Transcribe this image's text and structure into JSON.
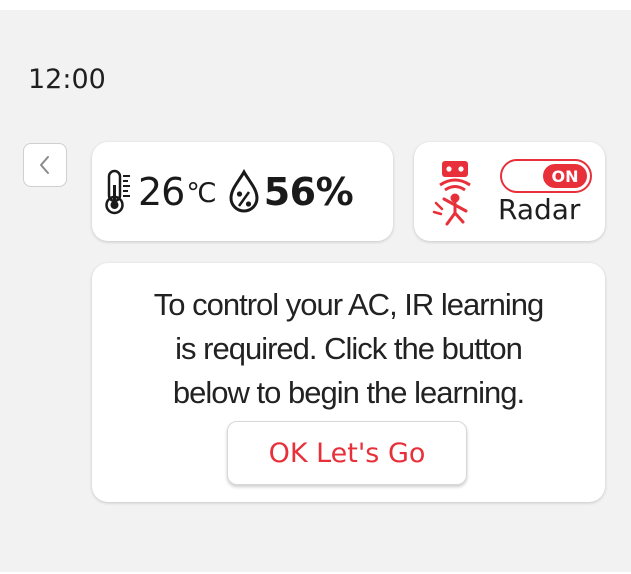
{
  "status_bar": {
    "time": "12:00"
  },
  "nav": {
    "back_icon": "chevron-left-icon"
  },
  "environment": {
    "temperature_icon": "thermometer-icon",
    "temperature_value": "26",
    "temperature_unit": "℃",
    "humidity_icon": "humidity-drop-icon",
    "humidity_value": "56%"
  },
  "radar": {
    "icon": "radar-person-icon",
    "toggle_state": "ON",
    "label": "Radar"
  },
  "info": {
    "message_lines": [
      "To control your AC, IR learning",
      "is required. Click the button",
      "below to begin the learning."
    ],
    "button_label": "OK Let's Go"
  },
  "colors": {
    "accent": "#e8303a",
    "background": "#f2f2f2",
    "card": "#ffffff",
    "text": "#1f1f1f"
  }
}
